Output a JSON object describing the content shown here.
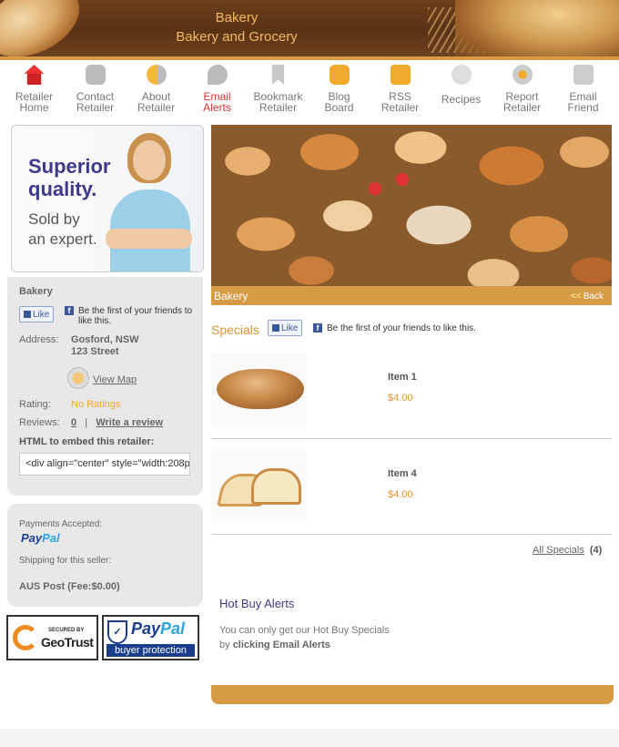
{
  "header": {
    "line1": "Bakery",
    "line2": "Bakery and Grocery"
  },
  "nav": [
    {
      "label1": "Retailer",
      "label2": "Home",
      "icon": "home-icon"
    },
    {
      "label1": "Contact",
      "label2": "Retailer",
      "icon": "chat-bubble-icon"
    },
    {
      "label1": "About",
      "label2": "Retailer",
      "icon": "about-people-icon"
    },
    {
      "label1": "Email",
      "label2": "Alerts",
      "icon": "alert-rss-icon",
      "active": true
    },
    {
      "label1": "Bookmark",
      "label2": "Retailer",
      "icon": "bookmark-icon"
    },
    {
      "label1": "Blog",
      "label2": "Board",
      "icon": "blog-bubble-icon"
    },
    {
      "label1": "RSS",
      "label2": "Retailer",
      "icon": "rss-icon"
    },
    {
      "label1": "Recipes",
      "label2": "",
      "icon": "chef-hat-icon"
    },
    {
      "label1": "Report",
      "label2": "Retailer",
      "icon": "report-pin-icon"
    },
    {
      "label1": "Email",
      "label2": "Friend",
      "icon": "envelope-icon"
    }
  ],
  "ad": {
    "headline1": "Superior",
    "headline2": "quality.",
    "sub1": "Sold by",
    "sub2": "an expert."
  },
  "retailer": {
    "name": "Bakery",
    "like_label": "Like",
    "like_text1": "Be the first of your friends to",
    "like_text2": "like this.",
    "address_label": "Address:",
    "address1": "Gosford, NSW",
    "address2": "123 Street",
    "view_map": "View Map",
    "rating_label": "Rating:",
    "rating_value": "No Ratings",
    "reviews_label": "Reviews:",
    "reviews_count": "0",
    "reviews_sep": "|",
    "write_review": "Write a review",
    "embed_heading": "HTML to embed this retailer:",
    "embed_code": "<div align=\"center\" style=\"width:208p"
  },
  "payment": {
    "accepted_label": "Payments Accepted:",
    "paypal_a": "Pay",
    "paypal_b": "Pal",
    "shipping_label": "Shipping for this seller:",
    "shipping_value": "AUS Post (Fee:$0.00)"
  },
  "badges": {
    "geotrust_secured": "SECURED BY",
    "geotrust_name": "GeoTrust",
    "paypal_a": "Pay",
    "paypal_b": "Pal",
    "paypal_protection": "buyer protection"
  },
  "hero": {
    "title": "Bakery",
    "back_arrows": "<<",
    "back": "Back"
  },
  "specials": {
    "title": "Specials",
    "like_label": "Like",
    "like_text": "Be the first of your friends to like this.",
    "items": [
      {
        "name": "Item 1",
        "price": "$4.00"
      },
      {
        "name": "Item 4",
        "price": "$4.00"
      }
    ],
    "all_label": "All Specials",
    "all_count": "(4)"
  },
  "hot_buy": {
    "title": "Hot Buy Alerts",
    "line1": "You can only get our Hot Buy Specials",
    "line2_prefix": "by",
    "line2_bold": "clicking Email Alerts"
  },
  "colors": {
    "accent": "#d79a45",
    "price": "#e0932c",
    "heading": "#3b3b8a",
    "active_nav": "#d33333"
  }
}
